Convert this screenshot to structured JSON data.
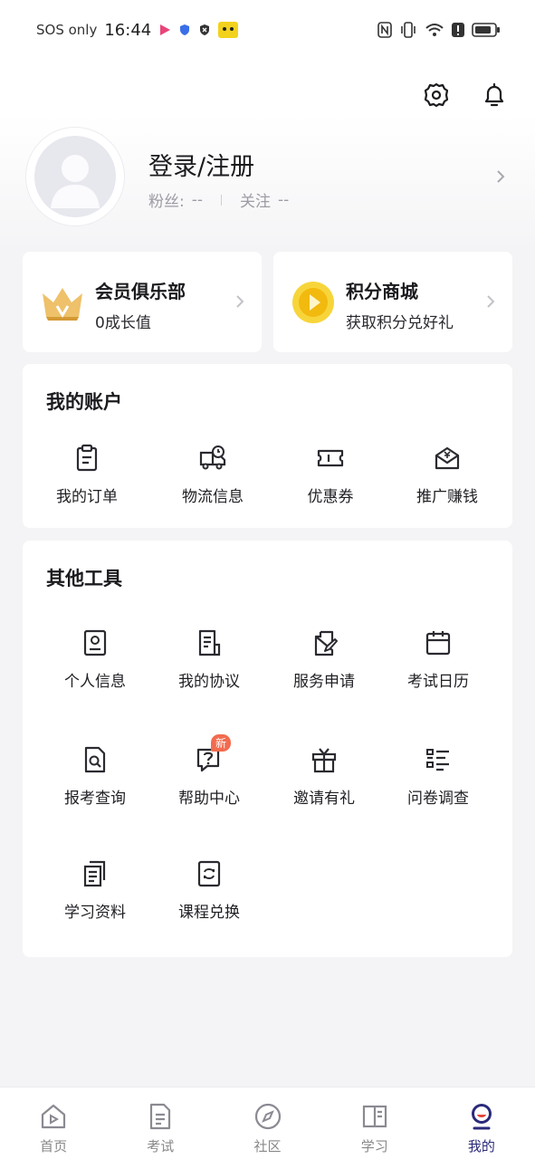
{
  "status_bar": {
    "carrier": "SOS only",
    "time": "16:44"
  },
  "profile": {
    "login_label": "登录/注册",
    "fans_label": "粉丝:",
    "fans_value": "--",
    "follow_label": "关注",
    "follow_value": "--"
  },
  "promo": {
    "vip": {
      "title": "会员俱乐部",
      "subtitle": "0成长值"
    },
    "points": {
      "title": "积分商城",
      "subtitle": "获取积分兑好礼"
    }
  },
  "account": {
    "title": "我的账户",
    "items": [
      {
        "label": "我的订单",
        "icon": "clipboard-icon"
      },
      {
        "label": "物流信息",
        "icon": "truck-icon"
      },
      {
        "label": "优惠券",
        "icon": "ticket-icon"
      },
      {
        "label": "推广赚钱",
        "icon": "money-envelope-icon"
      }
    ]
  },
  "tools": {
    "title": "其他工具",
    "items": [
      {
        "label": "个人信息",
        "icon": "id-card-icon"
      },
      {
        "label": "我的协议",
        "icon": "document-icon"
      },
      {
        "label": "服务申请",
        "icon": "edit-form-icon"
      },
      {
        "label": "考试日历",
        "icon": "calendar-icon"
      },
      {
        "label": "报考查询",
        "icon": "search-document-icon"
      },
      {
        "label": "帮助中心",
        "icon": "help-bubble-icon",
        "badge": "新"
      },
      {
        "label": "邀请有礼",
        "icon": "gift-icon"
      },
      {
        "label": "问卷调查",
        "icon": "checklist-icon"
      },
      {
        "label": "学习资料",
        "icon": "files-icon"
      },
      {
        "label": "课程兑换",
        "icon": "exchange-icon"
      }
    ]
  },
  "bottom_nav": [
    {
      "label": "首页",
      "icon": "home-icon"
    },
    {
      "label": "考试",
      "icon": "exam-icon"
    },
    {
      "label": "社区",
      "icon": "compass-icon"
    },
    {
      "label": "学习",
      "icon": "book-icon"
    },
    {
      "label": "我的",
      "icon": "profile-icon",
      "active": true
    }
  ],
  "colors": {
    "accent": "#2b2a7a",
    "badge": "#f26b4f",
    "crown": "#e9b84a",
    "coin": "#f5c518"
  }
}
